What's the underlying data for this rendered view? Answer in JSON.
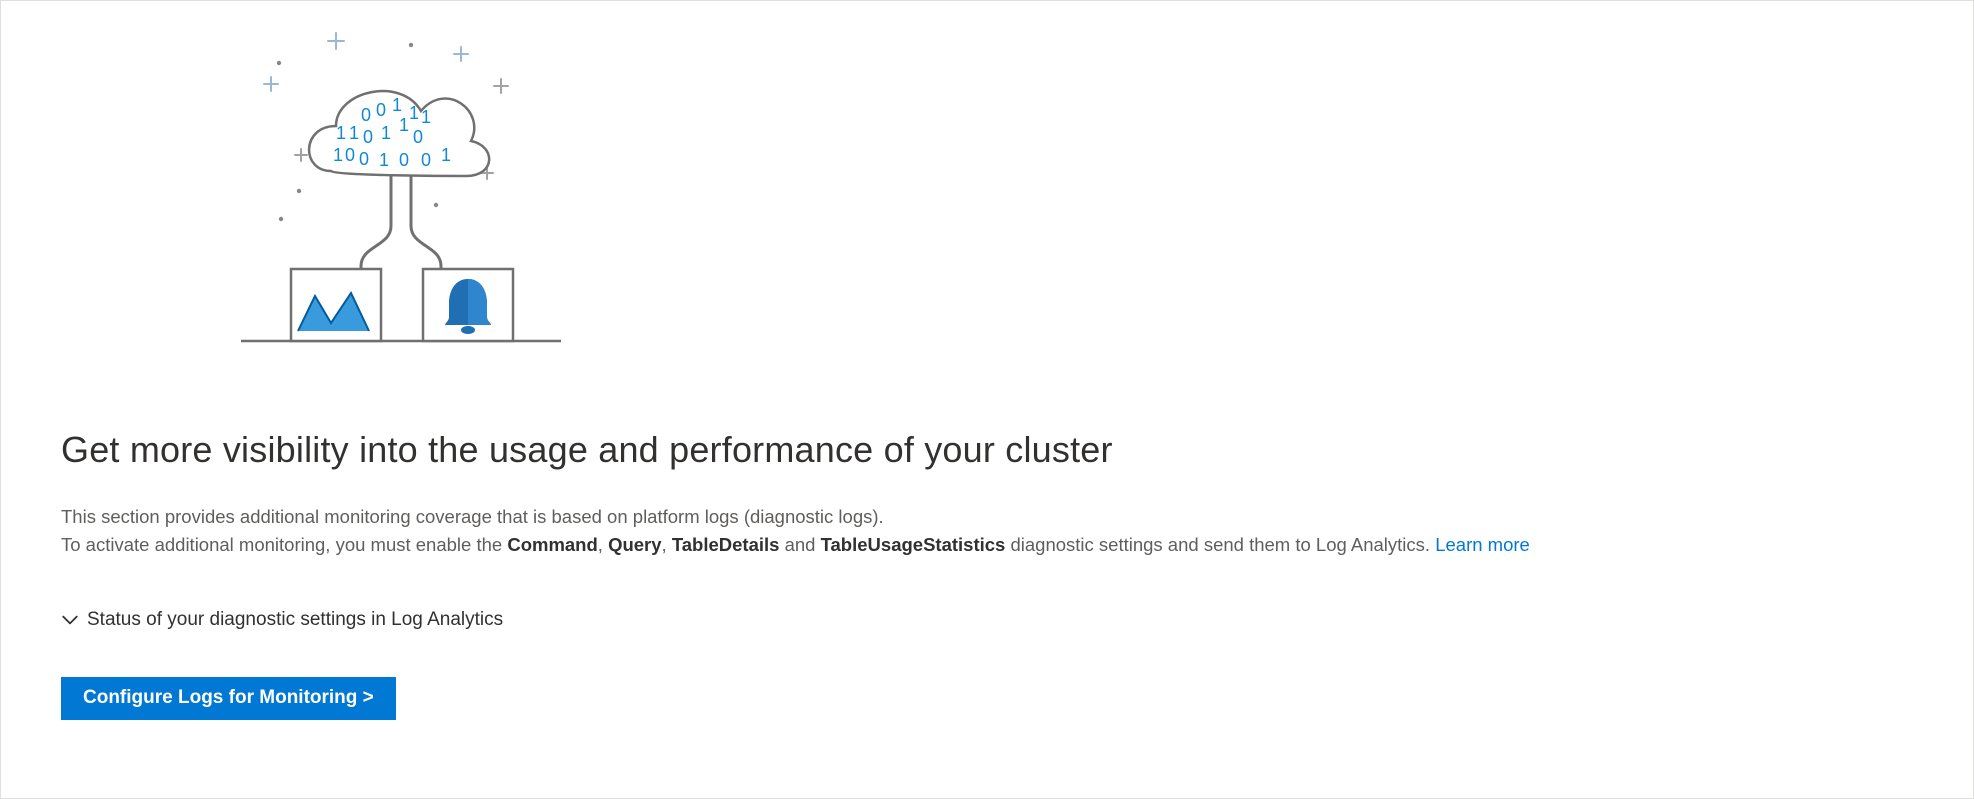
{
  "heading": "Get more visibility into the usage and performance of your cluster",
  "desc": {
    "line1": "This section provides additional monitoring coverage that is based on platform logs (diagnostic logs).",
    "pre": "To activate additional monitoring, you must enable the ",
    "b1": "Command",
    "sep1": ", ",
    "b2": "Query",
    "sep2": ", ",
    "b3": "TableDetails",
    "sep3": " and ",
    "b4": "TableUsageStatistics",
    "post": " diagnostic settings and send them to Log Analytics. ",
    "learn_more": "Learn more"
  },
  "expander_label": "Status of your diagnostic settings in Log Analytics",
  "cta_label": "Configure Logs for Monitoring >"
}
